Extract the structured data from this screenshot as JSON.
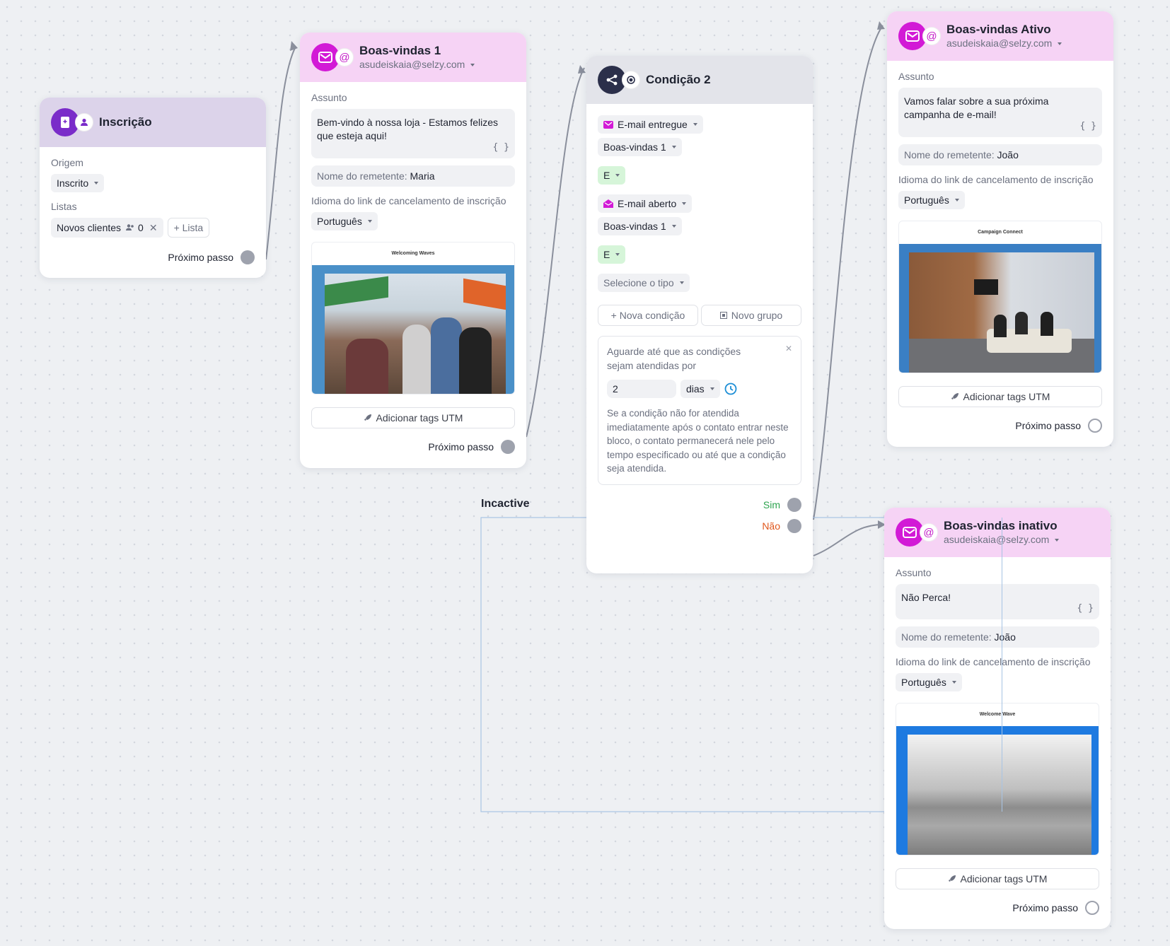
{
  "inscricao": {
    "title": "Inscrição",
    "origem_label": "Origem",
    "origem_value": "Inscrito",
    "listas_label": "Listas",
    "list_chip": "Novos clientes",
    "list_count": "0",
    "add_list": "+ Lista",
    "next_step": "Próximo passo"
  },
  "bv1": {
    "title": "Boas-vindas 1",
    "sender_email": "asudeiskaia@selzy.com",
    "assunto_label": "Assunto",
    "assunto_value": "Bem-vindo à nossa loja - Estamos felizes que esteja aqui!",
    "sender_name_label": "Nome do remetente:",
    "sender_name": "Maria",
    "lang_label": "Idioma do link de cancelamento de inscrição",
    "lang_value": "Português",
    "preview_title": "Welcoming Waves",
    "utm_button": "Adicionar tags UTM",
    "next_step": "Próximo passo"
  },
  "cond": {
    "title": "Condição 2",
    "c1": "E-mail entregue",
    "c1_sel": "Boas-vindas 1",
    "op1": "E",
    "c2": "E-mail aberto",
    "c2_sel": "Boas-vindas 1",
    "op2": "E",
    "type_select": "Selecione o tipo",
    "new_condition": "+ Nova condição",
    "new_group": "Novo grupo",
    "wait_text": "Aguarde até que as condições sejam atendidas por",
    "wait_value": "2",
    "wait_unit": "dias",
    "info": "Se a condição não for atendida imediatamente após o contato entrar neste bloco, o contato permanecerá nele pelo tempo especificado ou até que a condição seja atendida.",
    "yes": "Sim",
    "no": "Não"
  },
  "incactive_label": "Incactive",
  "ativo": {
    "title": "Boas-vindas Ativo",
    "sender_email": "asudeiskaia@selzy.com",
    "assunto_label": "Assunto",
    "assunto_value": "Vamos falar sobre a sua próxima campanha de e-mail!",
    "sender_name_label": "Nome do remetente:",
    "sender_name": "João",
    "lang_label": "Idioma do link de cancelamento de inscrição",
    "lang_value": "Português",
    "preview_title": "Campaign Connect",
    "utm_button": "Adicionar tags UTM",
    "next_step": "Próximo passo"
  },
  "inativo": {
    "title": "Boas-vindas inativo",
    "sender_email": "asudeiskaia@selzy.com",
    "assunto_label": "Assunto",
    "assunto_value": "Não Perca!",
    "sender_name_label": "Nome do remetente:",
    "sender_name": "João",
    "lang_label": "Idioma do link de cancelamento de inscrição",
    "lang_value": "Português",
    "preview_title": "Welcome Wave",
    "utm_button": "Adicionar tags UTM",
    "next_step": "Próximo passo"
  },
  "colors": {
    "email_accent": "#d21ad6",
    "subscribe_accent": "#7a2cc9",
    "condition_dark": "#2b2f4a",
    "yes": "#2ea44f",
    "no": "#e0561b"
  }
}
